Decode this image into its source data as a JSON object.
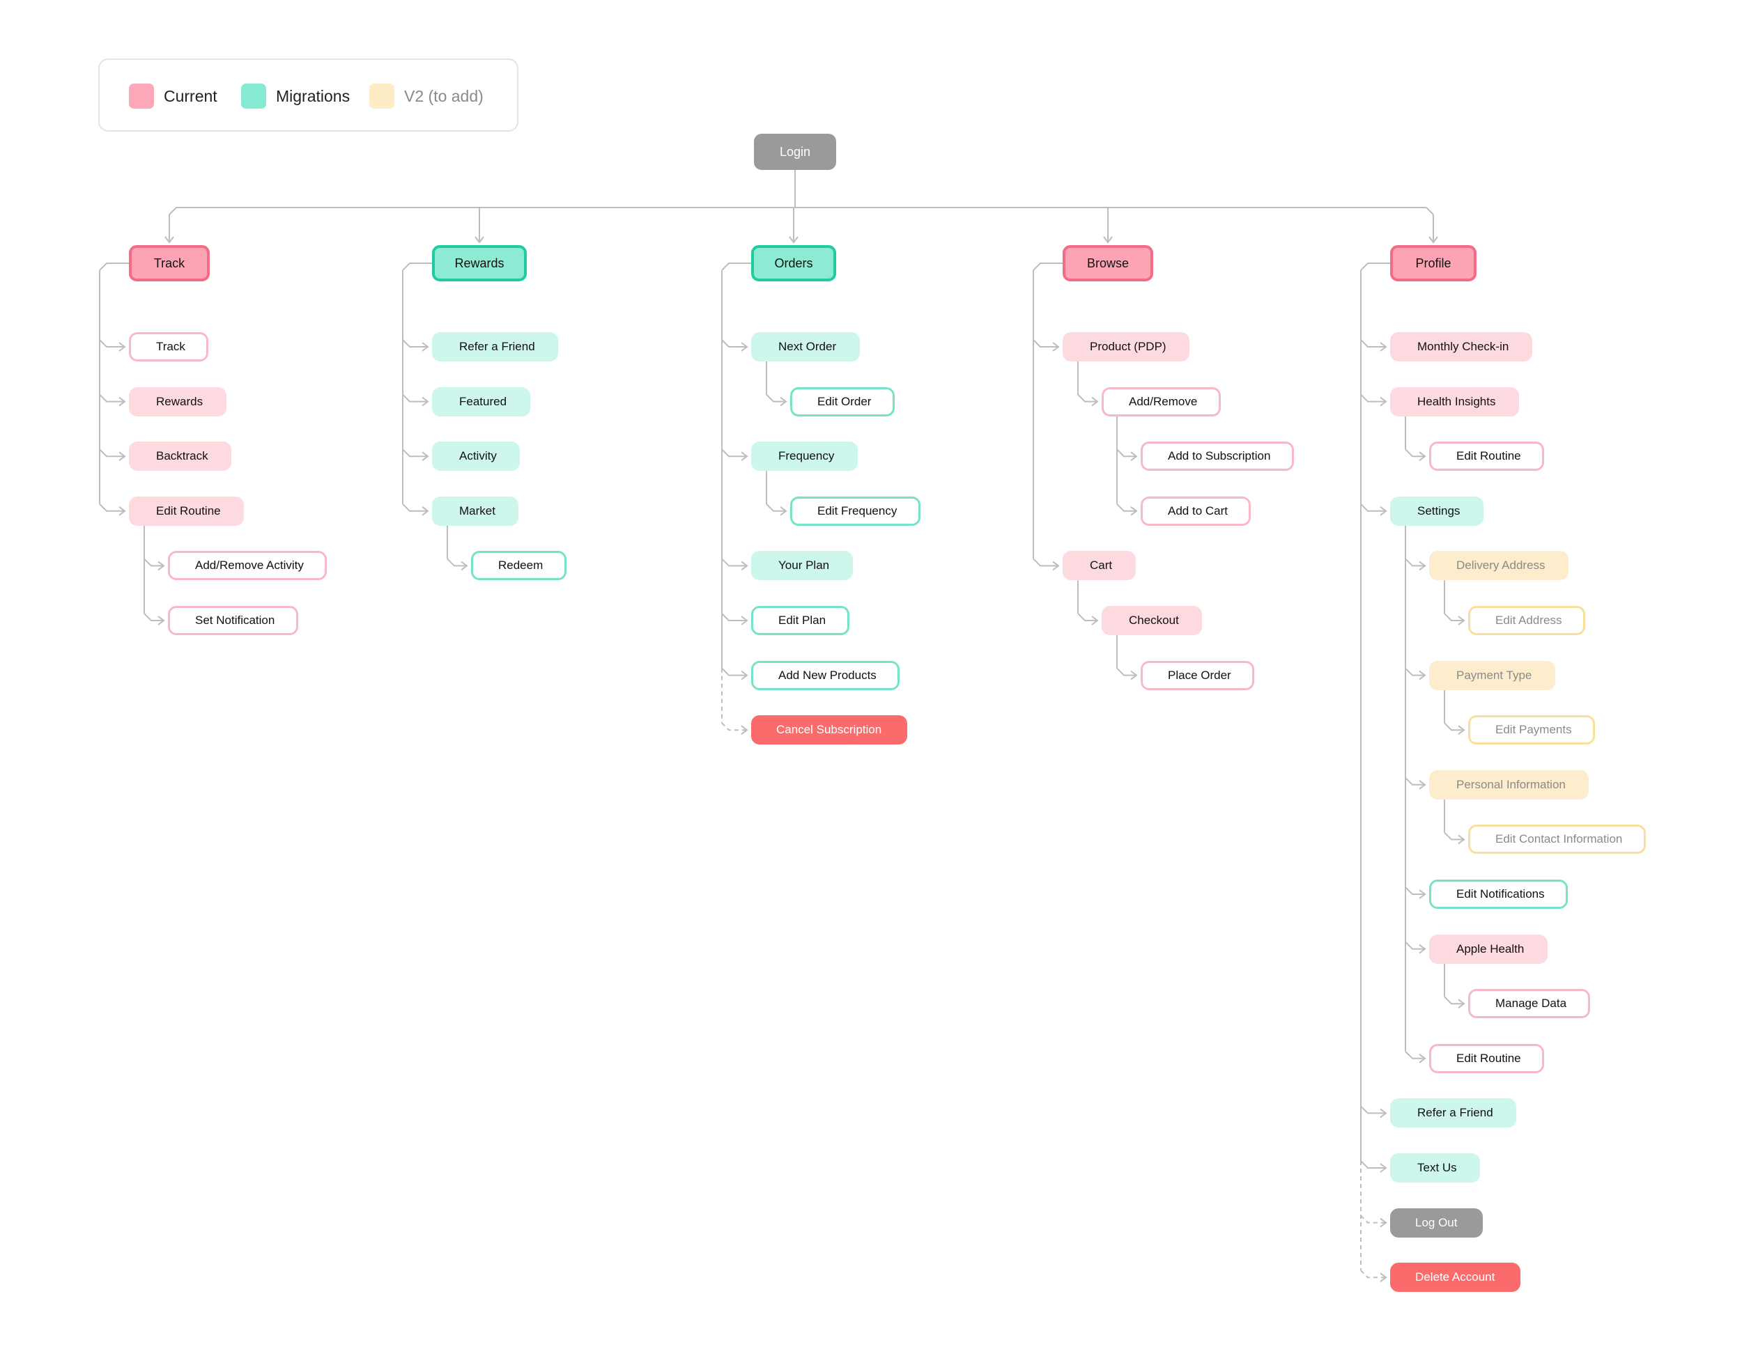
{
  "colors": {
    "current_fill": "#fdd9e0",
    "current_stroke": "#f7b9c6",
    "current_swatch": "#fca8b8",
    "current_header_fill": "#fca4b3",
    "current_header_stroke": "#f26c85",
    "migration_fill": "#cdf6ec",
    "migration_stroke": "#76e2c8",
    "migration_swatch": "#87ead3",
    "migration_header_fill": "#8dead3",
    "migration_header_stroke": "#20cc9f",
    "v2_fill": "#fdedcc",
    "v2_stroke": "#f9df9e",
    "v2_swatch": "#fdecc6",
    "danger": "#fb6b6b",
    "gray": "#9a9a9a",
    "connector": "#bdbdbd"
  },
  "legend": [
    {
      "label": "Current",
      "type": "current"
    },
    {
      "label": "Migrations",
      "type": "migration"
    },
    {
      "label": "V2 (to add)",
      "type": "v2"
    }
  ],
  "diagram": {
    "login": "Login",
    "columns": [
      {
        "key": "track",
        "header": {
          "label": "Track",
          "type": "current"
        },
        "items": [
          {
            "label": "Track",
            "type": "current",
            "style": "outline"
          },
          {
            "label": "Rewards",
            "type": "current",
            "style": "filled"
          },
          {
            "label": "Backtrack",
            "type": "current",
            "style": "filled"
          },
          {
            "label": "Edit Routine",
            "type": "current",
            "style": "filled",
            "children": [
              {
                "label": "Add/Remove Activity",
                "type": "current",
                "style": "outline"
              },
              {
                "label": "Set Notification",
                "type": "current",
                "style": "outline"
              }
            ]
          }
        ]
      },
      {
        "key": "rewards",
        "header": {
          "label": "Rewards",
          "type": "migration"
        },
        "items": [
          {
            "label": "Refer a Friend",
            "type": "migration",
            "style": "filled"
          },
          {
            "label": "Featured",
            "type": "migration",
            "style": "filled"
          },
          {
            "label": "Activity",
            "type": "migration",
            "style": "filled"
          },
          {
            "label": "Market",
            "type": "migration",
            "style": "filled",
            "children": [
              {
                "label": "Redeem",
                "type": "migration",
                "style": "outline"
              }
            ]
          }
        ]
      },
      {
        "key": "orders",
        "header": {
          "label": "Orders",
          "type": "migration"
        },
        "items": [
          {
            "label": "Next Order",
            "type": "migration",
            "style": "filled",
            "children": [
              {
                "label": "Edit Order",
                "type": "migration",
                "style": "outline"
              }
            ]
          },
          {
            "label": "Frequency",
            "type": "migration",
            "style": "filled",
            "children": [
              {
                "label": "Edit Frequency",
                "type": "migration",
                "style": "outline"
              }
            ]
          },
          {
            "label": "Your Plan",
            "type": "migration",
            "style": "filled"
          },
          {
            "label": "Edit Plan",
            "type": "migration",
            "style": "outline"
          },
          {
            "label": "Add New Products",
            "type": "migration",
            "style": "outline"
          },
          {
            "label": "Cancel Subscription",
            "type": "danger",
            "style": "solid",
            "dashed": true
          }
        ]
      },
      {
        "key": "browse",
        "header": {
          "label": "Browse",
          "type": "current"
        },
        "items": [
          {
            "label": "Product (PDP)",
            "type": "current",
            "style": "filled",
            "children": [
              {
                "label": "Add/Remove",
                "type": "current",
                "style": "outline",
                "children": [
                  {
                    "label": "Add to Subscription",
                    "type": "current",
                    "style": "outline"
                  },
                  {
                    "label": "Add to Cart",
                    "type": "current",
                    "style": "outline"
                  }
                ]
              }
            ]
          },
          {
            "label": "Cart",
            "type": "current",
            "style": "filled",
            "children": [
              {
                "label": "Checkout",
                "type": "current",
                "style": "filled",
                "children": [
                  {
                    "label": "Place Order",
                    "type": "current",
                    "style": "outline"
                  }
                ]
              }
            ]
          }
        ]
      },
      {
        "key": "profile",
        "header": {
          "label": "Profile",
          "type": "current"
        },
        "items": [
          {
            "label": "Monthly Check-in",
            "type": "current",
            "style": "filled"
          },
          {
            "label": "Health Insights",
            "type": "current",
            "style": "filled",
            "children": [
              {
                "label": "Edit Routine",
                "type": "current",
                "style": "outline"
              }
            ]
          },
          {
            "label": "Settings",
            "type": "migration",
            "style": "filled",
            "children": [
              {
                "label": "Delivery Address",
                "type": "v2",
                "style": "filled",
                "children": [
                  {
                    "label": "Edit Address",
                    "type": "v2",
                    "style": "outline"
                  }
                ]
              },
              {
                "label": "Payment Type",
                "type": "v2",
                "style": "filled",
                "children": [
                  {
                    "label": "Edit Payments",
                    "type": "v2",
                    "style": "outline"
                  }
                ]
              },
              {
                "label": "Personal Information",
                "type": "v2",
                "style": "filled",
                "children": [
                  {
                    "label": "Edit Contact Information",
                    "type": "v2",
                    "style": "outline"
                  }
                ]
              },
              {
                "label": "Edit Notifications",
                "type": "migration",
                "style": "outline"
              },
              {
                "label": "Apple Health",
                "type": "current",
                "style": "filled",
                "children": [
                  {
                    "label": "Manage Data",
                    "type": "current",
                    "style": "outline"
                  }
                ]
              },
              {
                "label": "Edit Routine",
                "type": "current",
                "style": "outline"
              }
            ]
          },
          {
            "label": "Refer a Friend",
            "type": "migration",
            "style": "filled"
          },
          {
            "label": "Text Us",
            "type": "migration",
            "style": "filled"
          },
          {
            "label": "Log Out",
            "type": "gray",
            "style": "solid",
            "dashed": true
          },
          {
            "label": "Delete Account",
            "type": "danger",
            "style": "solid",
            "dashed": true
          }
        ]
      }
    ]
  }
}
